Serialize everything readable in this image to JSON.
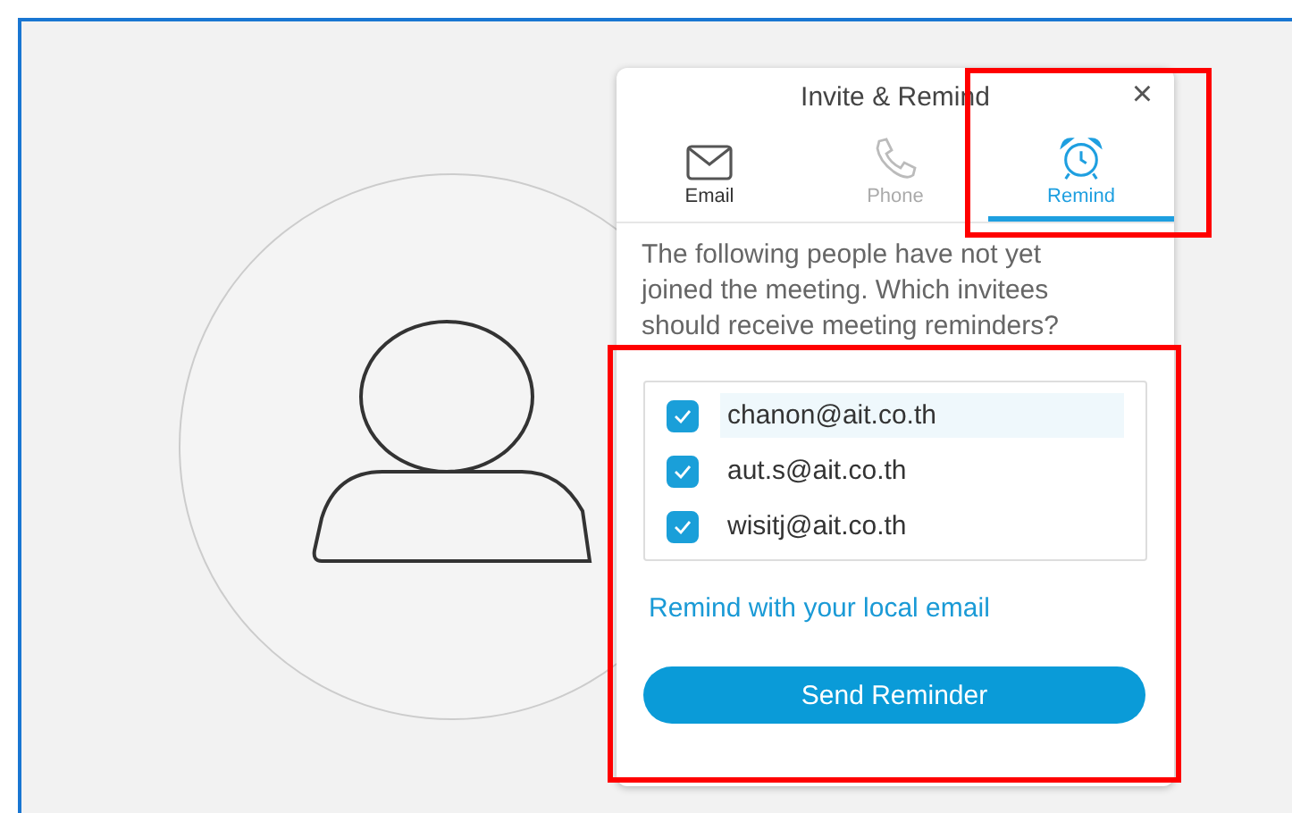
{
  "dialog": {
    "title": "Invite & Remind",
    "close": "×"
  },
  "tabs": [
    {
      "label": "Email",
      "kind": "email",
      "selected": false,
      "disabled": false
    },
    {
      "label": "Phone",
      "kind": "phone",
      "selected": false,
      "disabled": true
    },
    {
      "label": "Remind",
      "kind": "alarm",
      "selected": true,
      "disabled": false
    }
  ],
  "message": "The following people have not yet joined the meeting. Which invitees should receive meeting reminders?",
  "invitees": [
    {
      "email": "chanon@ait.co.th",
      "checked": true,
      "highlighted": true
    },
    {
      "email": "aut.s@ait.co.th",
      "checked": true,
      "highlighted": false
    },
    {
      "email": "wisitj@ait.co.th",
      "checked": true,
      "highlighted": false
    }
  ],
  "link": "Remind with your local email",
  "button": "Send Reminder"
}
